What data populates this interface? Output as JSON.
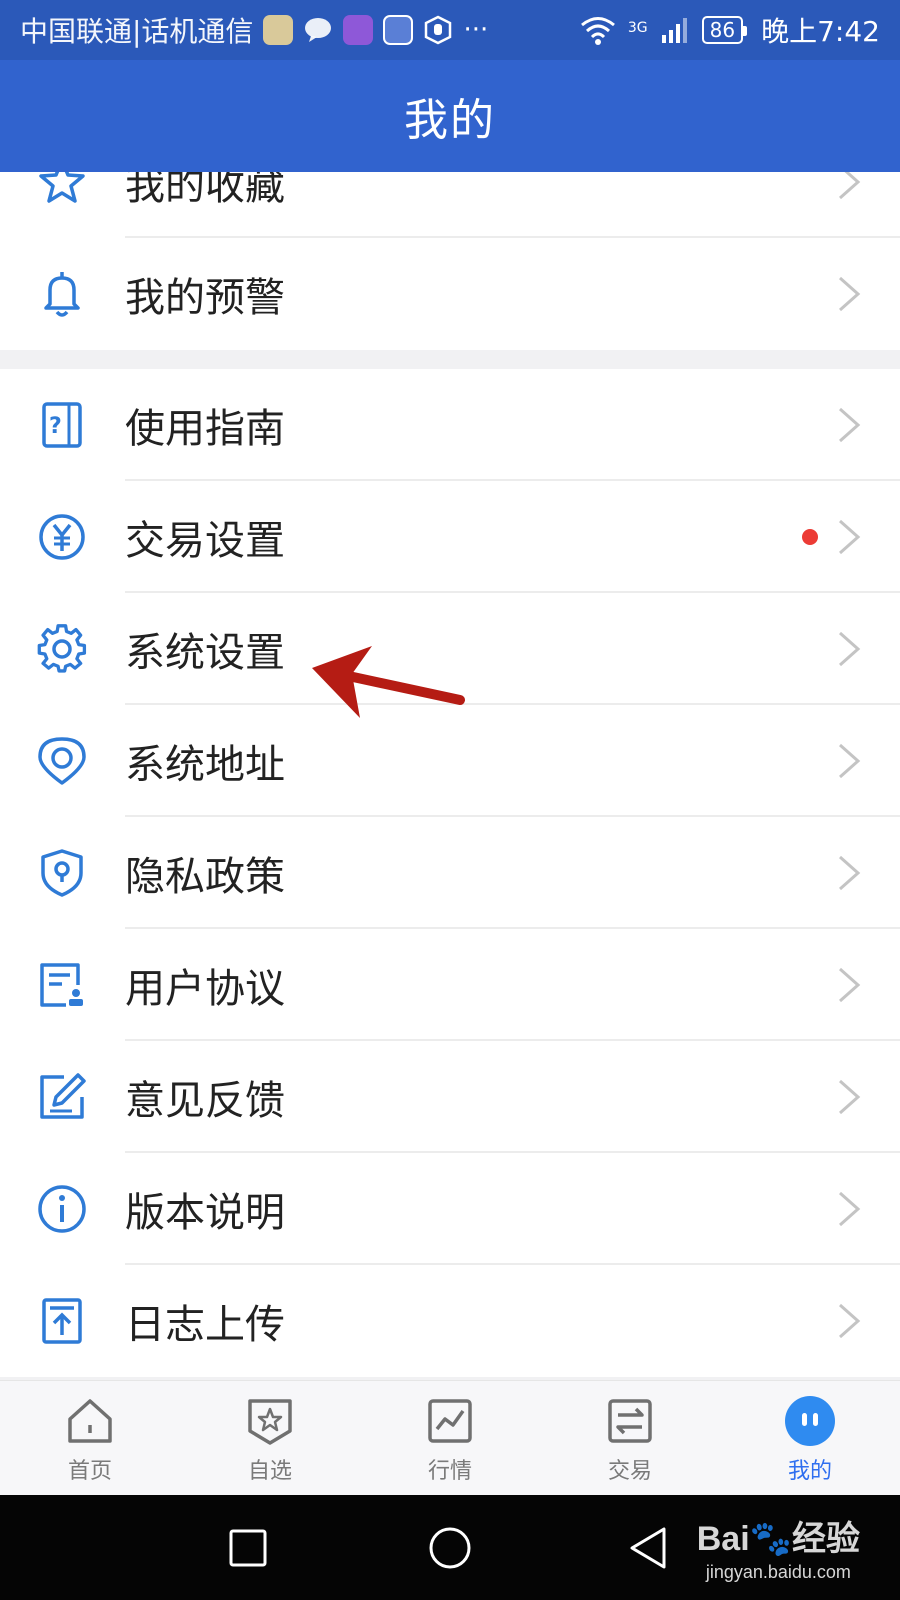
{
  "status_bar": {
    "carrier": "中国联通|话机通信",
    "more": "···",
    "network": "3G",
    "battery": "86",
    "time": "晚上7:42"
  },
  "header": {
    "title": "我的"
  },
  "menu_group_1": [
    {
      "label": "我的收藏",
      "icon": "star-icon"
    },
    {
      "label": "我的预警",
      "icon": "bell-icon"
    }
  ],
  "menu_group_2": [
    {
      "label": "使用指南",
      "icon": "guide-icon"
    },
    {
      "label": "交易设置",
      "icon": "yen-icon",
      "badge": "red-dot"
    },
    {
      "label": "系统设置",
      "icon": "gear-icon"
    },
    {
      "label": "系统地址",
      "icon": "location-icon"
    },
    {
      "label": "隐私政策",
      "icon": "shield-lock-icon"
    },
    {
      "label": "用户协议",
      "icon": "agreement-icon"
    },
    {
      "label": "意见反馈",
      "icon": "edit-icon"
    },
    {
      "label": "版本说明",
      "icon": "info-icon"
    },
    {
      "label": "日志上传",
      "icon": "upload-icon"
    }
  ],
  "bottom_nav": [
    {
      "label": "首页",
      "icon": "home-icon"
    },
    {
      "label": "自选",
      "icon": "favorite-icon"
    },
    {
      "label": "行情",
      "icon": "chart-icon"
    },
    {
      "label": "交易",
      "icon": "exchange-icon"
    },
    {
      "label": "我的",
      "icon": "profile-icon",
      "active": true
    }
  ],
  "colors": {
    "status_bar": "#2b59b9",
    "header": "#3163ce",
    "icon_blue": "#2f7bd6",
    "active_tab": "#2f6ff0",
    "badge_red": "#ec3b35",
    "arrow_red": "#b51c14"
  },
  "watermark": {
    "main": "Bai🐾经验",
    "sub": "jingyan.baidu.com"
  }
}
